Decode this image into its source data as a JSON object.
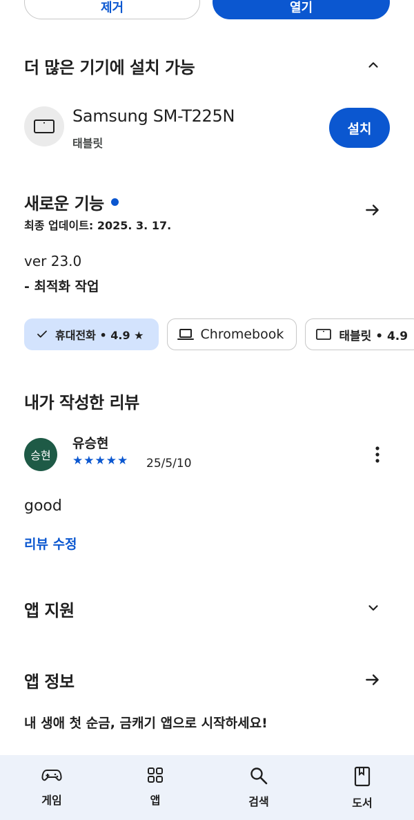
{
  "top_buttons": {
    "secondary_label": "제거",
    "primary_label": "열기"
  },
  "more_devices": {
    "title": "더 많은 기기에 설치 가능",
    "device_name": "Samsung SM-T225N",
    "device_type": "태블릿",
    "install_label": "설치"
  },
  "whats_new": {
    "title": "새로운 기능",
    "last_updated": "최종 업데이트: 2025. 3. 17.",
    "version": "ver 23.0",
    "notes": "- 최적화 작업"
  },
  "device_chips": [
    {
      "label": "휴대전화 • 4.9 ★",
      "icon": "check-icon",
      "selected": true
    },
    {
      "label": "Chromebook",
      "icon": "laptop-icon",
      "selected": false
    },
    {
      "label": "태블릿 • 4.9",
      "icon": "tablet-icon",
      "selected": false
    }
  ],
  "my_review": {
    "title": "내가 작성한 리뷰",
    "avatar_text": "승현",
    "reviewer": "유승현",
    "stars": "★★★★★",
    "rating": 5,
    "date": "25/5/10",
    "text": "good",
    "edit_label": "리뷰 수정"
  },
  "app_support": {
    "title": "앱 지원"
  },
  "app_info": {
    "title": "앱 정보",
    "promo": "내 생애 첫 순금, 금캐기 앱으로 시작하세요!"
  },
  "bottom_nav": [
    {
      "label": "게임",
      "icon": "gamepad-icon"
    },
    {
      "label": "앱",
      "icon": "apps-grid-icon"
    },
    {
      "label": "검색",
      "icon": "search-icon"
    },
    {
      "label": "도서",
      "icon": "book-icon"
    }
  ],
  "colors": {
    "accent": "#0b57d0",
    "chip_selected": "#d3e3fd",
    "nav_bg": "#edf2fa",
    "avatar_bg": "#1e5a46"
  }
}
